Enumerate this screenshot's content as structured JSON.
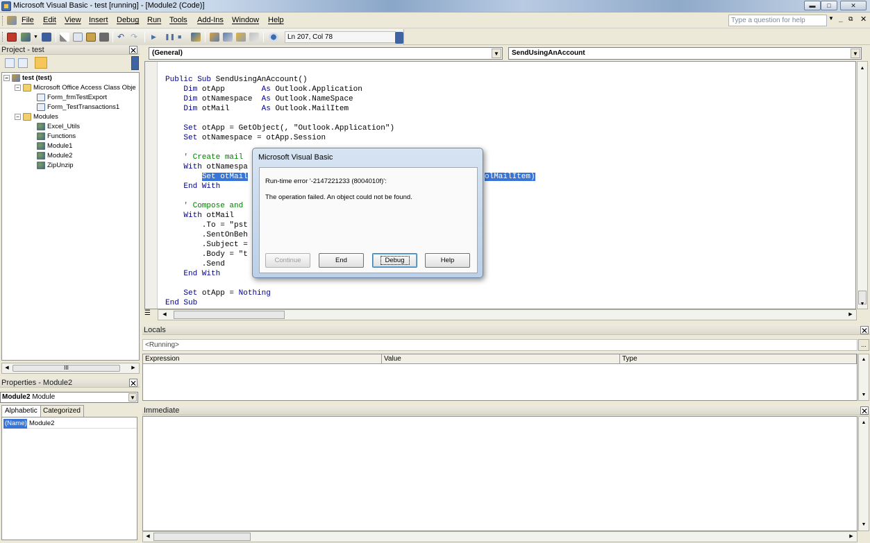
{
  "window": {
    "title": "Microsoft Visual Basic - test [running] - [Module2 (Code)]"
  },
  "menubar": {
    "items": [
      "File",
      "Edit",
      "View",
      "Insert",
      "Debug",
      "Run",
      "Tools",
      "Add-Ins",
      "Window",
      "Help"
    ],
    "help_placeholder": "Type a question for help"
  },
  "toolbar": {
    "cursor_position": "Ln 207, Col 78"
  },
  "project_pane": {
    "title": "Project - test",
    "tree": [
      {
        "label": "test (test)",
        "bold": true
      },
      {
        "label": "Microsoft Office Access Class Obje"
      },
      {
        "label": "Form_frmTestExport"
      },
      {
        "label": "Form_TestTransactions1"
      },
      {
        "label": "Modules"
      },
      {
        "label": "Excel_Utils"
      },
      {
        "label": "Functions"
      },
      {
        "label": "Module1"
      },
      {
        "label": "Module2"
      },
      {
        "label": "ZipUnzip"
      }
    ],
    "hscroll_label": "III"
  },
  "properties_pane": {
    "title": "Properties - Module2",
    "object_name": "Module2",
    "object_type": "Module",
    "tabs": [
      "Alphabetic",
      "Categorized"
    ],
    "rows": [
      {
        "name": "(Name)",
        "value": "Module2"
      }
    ]
  },
  "code_window": {
    "object_combo": "(General)",
    "proc_combo": "SendUsingAnAccount",
    "lines": [
      {
        "text": "Public Sub SendUsingAnAccount()"
      },
      {
        "text": "    Dim otApp        As Outlook.Application"
      },
      {
        "text": "    Dim otNamespace  As Outlook.NameSpace"
      },
      {
        "text": "    Dim otMail       As Outlook.MailItem"
      },
      {
        "text": ""
      },
      {
        "text": "    Set otApp = GetObject(, \"Outlook.Application\")"
      },
      {
        "text": "    Set otNamespace = otApp.Session"
      },
      {
        "text": ""
      },
      {
        "text": "    ' Create mail"
      },
      {
        "text": "    With otNamespa"
      },
      {
        "text": "        Set otMail"
      },
      {
        "text": "    End With"
      },
      {
        "text": ""
      },
      {
        "text": "    ' Compose and"
      },
      {
        "text": "    With otMail"
      },
      {
        "text": "        .To = \"pst"
      },
      {
        "text": "        .SentOnBeh"
      },
      {
        "text": "        .Subject ="
      },
      {
        "text": "        .Body = \"t"
      },
      {
        "text": "        .Send"
      },
      {
        "text": "    End With"
      },
      {
        "text": ""
      },
      {
        "text": "    Set otApp = Nothing"
      },
      {
        "text": "End Sub"
      }
    ],
    "highlight_tail": "olMailItem)"
  },
  "locals_pane": {
    "title": "Locals",
    "status": "<Running>",
    "more_label": "...",
    "columns": [
      "Expression",
      "Value",
      "Type"
    ]
  },
  "immediate_pane": {
    "title": "Immediate"
  },
  "dialog": {
    "title": "Microsoft Visual Basic",
    "error_line": "Run-time error '-2147221233 (8004010f)':",
    "message": "The operation failed. An object could not be found.",
    "buttons": {
      "continue": "Continue",
      "end": "End",
      "debug": "Debug",
      "help": "Help"
    }
  }
}
